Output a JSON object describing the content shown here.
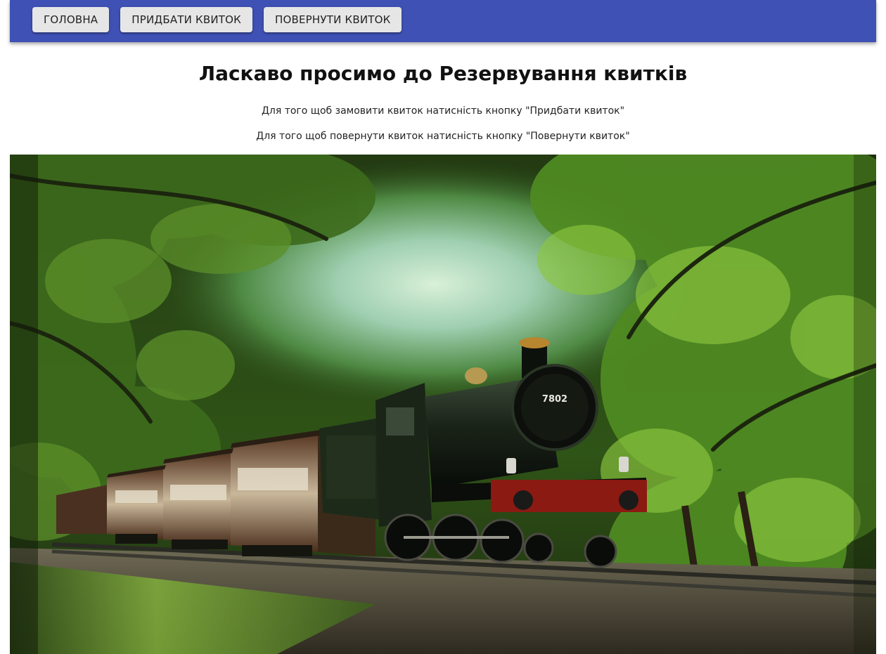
{
  "nav": {
    "home_label": "ГОЛОВНА",
    "buy_label": "ПРИДБАТИ КВИТОК",
    "return_label": "ПОВЕРНУТИ КВИТОК"
  },
  "main": {
    "title": "Ласкаво просимо до Резервування квитків",
    "line_buy": "Для того щоб замовити квиток натисність кнопку \"Придбати квиток\"",
    "line_return": "Для того щоб повернути квиток натисність кнопку \"Повернути квиток\""
  },
  "hero": {
    "locomotive_number": "7802"
  },
  "colors": {
    "app_bar": "#3f51b5",
    "button_bg": "#e6e6e6",
    "buffer_beam": "#8b1a12",
    "foliage": "#3f6d1e"
  }
}
